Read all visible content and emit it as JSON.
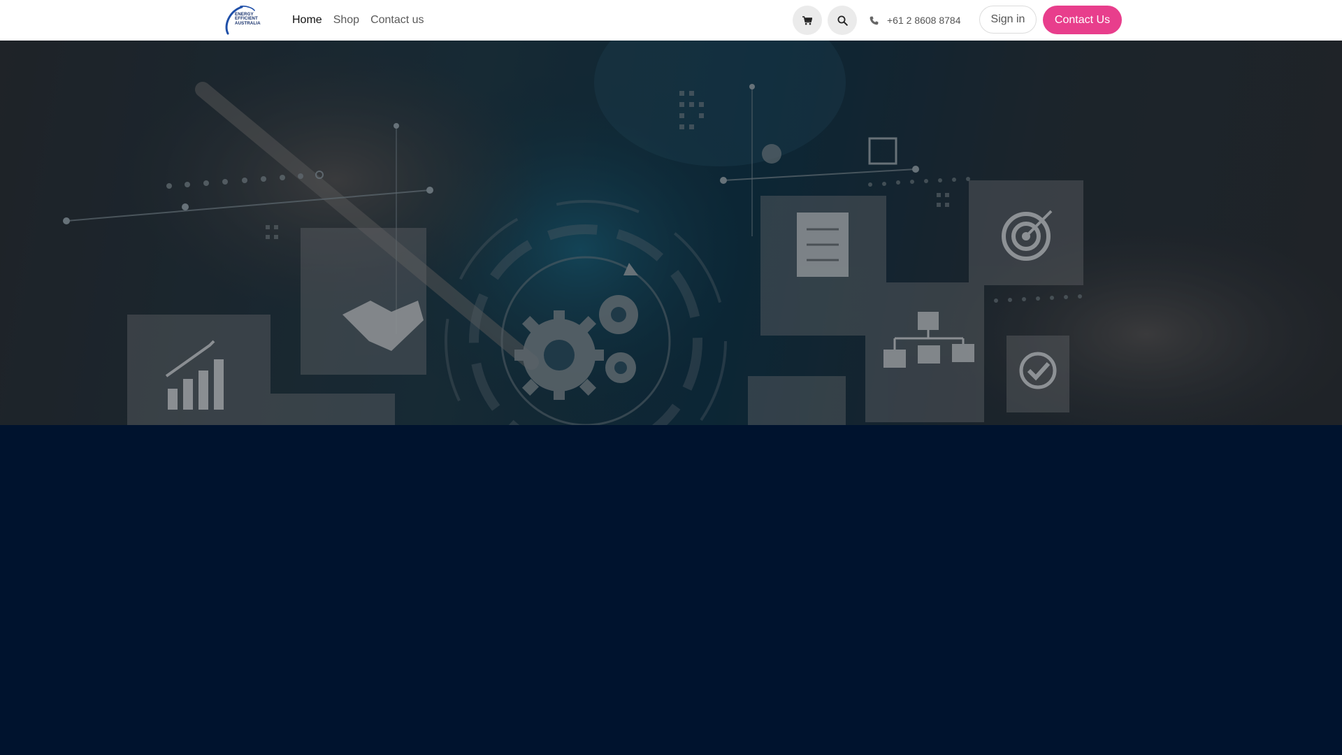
{
  "brand": {
    "logo_alt": "Energy Efficient Australia",
    "logo_lines": [
      "ENERGY",
      "EFFICIENT",
      "AUSTRALIA"
    ]
  },
  "nav": {
    "links": [
      {
        "label": "Home",
        "active": true
      },
      {
        "label": "Shop",
        "active": false
      },
      {
        "label": "Contact us",
        "active": false
      }
    ]
  },
  "header": {
    "cart_icon": "cart-icon",
    "search_icon": "search-icon",
    "phone_icon": "phone-icon",
    "phone": "+61 2 8608 8784",
    "signin_label": "Sign in",
    "contact_label": "Contact Us"
  },
  "hero": {
    "image_alt": "Business process and technology concept"
  },
  "colors": {
    "accent": "#e83e8c",
    "footer_bg": "#00132e",
    "logo": "#16306b"
  }
}
